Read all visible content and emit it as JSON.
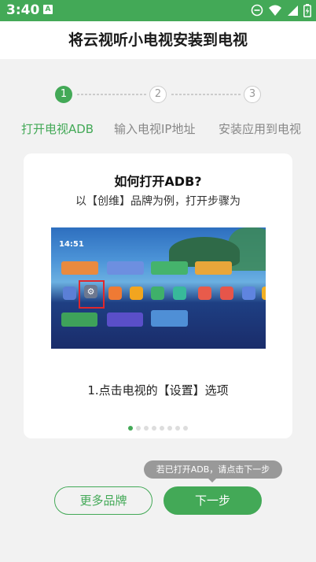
{
  "status_bar": {
    "time": "3:40",
    "notification_icon": "A"
  },
  "header": {
    "title": "将云视听小电视安装到电视"
  },
  "stepper": {
    "steps": [
      {
        "number": "1",
        "label": "打开电视ADB",
        "active": true
      },
      {
        "number": "2",
        "label": "输入电视IP地址",
        "active": false
      },
      {
        "number": "3",
        "label": "安装应用到电视",
        "active": false
      }
    ]
  },
  "guide_card": {
    "title": "如何打开ADB?",
    "subtitle": "以【创维】品牌为例，打开步骤为",
    "caption": "1.点击电视的【设置】选项",
    "page_count": 8,
    "current_page": 1
  },
  "tv_screenshot": {
    "clock": "14:51"
  },
  "tooltip": {
    "text": "若已打开ADB，请点击下一步"
  },
  "buttons": {
    "more_brands": "更多品牌",
    "next": "下一步"
  },
  "colors": {
    "accent": "#43a957",
    "highlight": "#e0282c"
  },
  "icons": [
    "minus-circle-icon",
    "wifi-icon",
    "signal-icon",
    "battery-icon",
    "settings-gear-icon"
  ]
}
